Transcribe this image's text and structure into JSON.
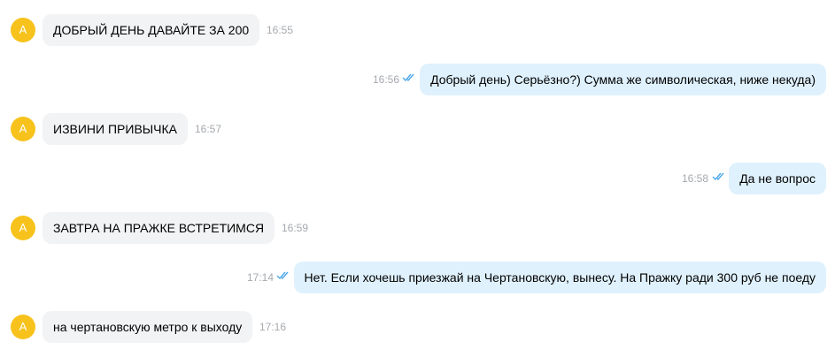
{
  "colors": {
    "avatar": "#f7c21b",
    "incoming_bubble": "#f2f3f5",
    "outgoing_bubble": "#dff1fd",
    "time": "#a5a9ae",
    "read_check": "#4ca7e8"
  },
  "messages": [
    {
      "direction": "in",
      "avatar": "A",
      "text": "ДОБРЫЙ ДЕНЬ ДАВАЙТЕ ЗА 200",
      "time": "16:55"
    },
    {
      "direction": "out",
      "text": "Добрый день) Серьёзно?) Сумма же символическая, ниже некуда)",
      "time": "16:56",
      "status_icon": "double-check-icon"
    },
    {
      "direction": "in",
      "avatar": "A",
      "text": "ИЗВИНИ ПРИВЫЧКА",
      "time": "16:57"
    },
    {
      "direction": "out",
      "text": "Да не вопрос",
      "time": "16:58",
      "status_icon": "double-check-icon"
    },
    {
      "direction": "in",
      "avatar": "A",
      "text": "ЗАВТРА НА ПРАЖКЕ ВСТРЕТИМСЯ",
      "time": "16:59"
    },
    {
      "direction": "out",
      "text": "Нет. Если хочешь приезжай на Чертановскую, вынесу. На Пражку ради 300 руб не поеду",
      "time": "17:14",
      "status_icon": "double-check-icon"
    },
    {
      "direction": "in",
      "avatar": "A",
      "text": "на чертановскую метро к выходу",
      "time": "17:16"
    }
  ]
}
